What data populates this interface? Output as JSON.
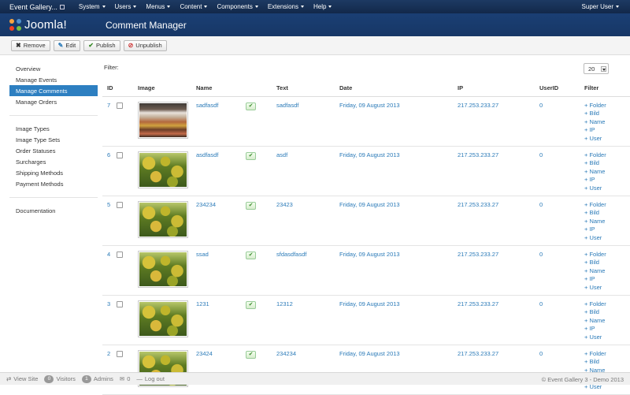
{
  "topnav": {
    "site_name": "Event Gallery...",
    "menu": [
      "System",
      "Users",
      "Menus",
      "Content",
      "Components",
      "Extensions",
      "Help"
    ],
    "user": "Super User"
  },
  "header": {
    "logo_text": "Joomla!",
    "title": "Comment Manager"
  },
  "toolbar": {
    "remove_label": "Remove",
    "edit_label": "Edit",
    "publish_label": "Publish",
    "unpublish_label": "Unpublish"
  },
  "sidebar": {
    "group1": [
      "Overview",
      "Manage Events",
      "Manage Comments",
      "Manage Orders"
    ],
    "group2": [
      "Image Types",
      "Image Type Sets",
      "Order Statuses",
      "Surcharges",
      "Shipping Methods",
      "Payment Methods"
    ],
    "group3": [
      "Documentation"
    ],
    "active": "Manage Comments"
  },
  "main": {
    "filter_label": "Filter:",
    "page_size": "20",
    "columns": [
      "ID",
      "",
      "Image",
      "Name",
      "",
      "Text",
      "Date",
      "IP",
      "UserID",
      "Filter"
    ],
    "filter_links": [
      "+ Folder",
      "+ Bild",
      "+ Name",
      "+ IP",
      "+ User"
    ],
    "rows": [
      {
        "id": "7",
        "image": "spices",
        "name": "sadfasdf",
        "text": "sadfasdf",
        "date": "Friday, 09 August 2013",
        "ip": "217.253.233.27",
        "userid": "0"
      },
      {
        "id": "6",
        "image": "fruit",
        "name": "asdfasdf",
        "text": "asdf",
        "date": "Friday, 09 August 2013",
        "ip": "217.253.233.27",
        "userid": "0"
      },
      {
        "id": "5",
        "image": "fruit",
        "name": "234234",
        "text": "23423",
        "date": "Friday, 09 August 2013",
        "ip": "217.253.233.27",
        "userid": "0"
      },
      {
        "id": "4",
        "image": "fruit",
        "name": "ssad",
        "text": "sfdasdfasdf",
        "date": "Friday, 09 August 2013",
        "ip": "217.253.233.27",
        "userid": "0"
      },
      {
        "id": "3",
        "image": "fruit",
        "name": "1231",
        "text": "12312",
        "date": "Friday, 09 August 2013",
        "ip": "217.253.233.27",
        "userid": "0"
      },
      {
        "id": "2",
        "image": "fruit",
        "name": "23424",
        "text": "234234",
        "date": "Friday, 09 August 2013",
        "ip": "217.253.233.27",
        "userid": "0"
      }
    ]
  },
  "statusbar": {
    "view_site": "View Site",
    "visitors_count": "0",
    "visitors_label": "Visitors",
    "admins_count": "1",
    "admins_label": "Admins",
    "messages_count": "0",
    "logout": "Log out",
    "copyright": "© Event Gallery 3 - Demo 2013"
  },
  "colors": {
    "topnav": "#12284a",
    "header": "#1a3f74",
    "active_item": "#2d7fc1",
    "link": "#2a7ab8"
  }
}
